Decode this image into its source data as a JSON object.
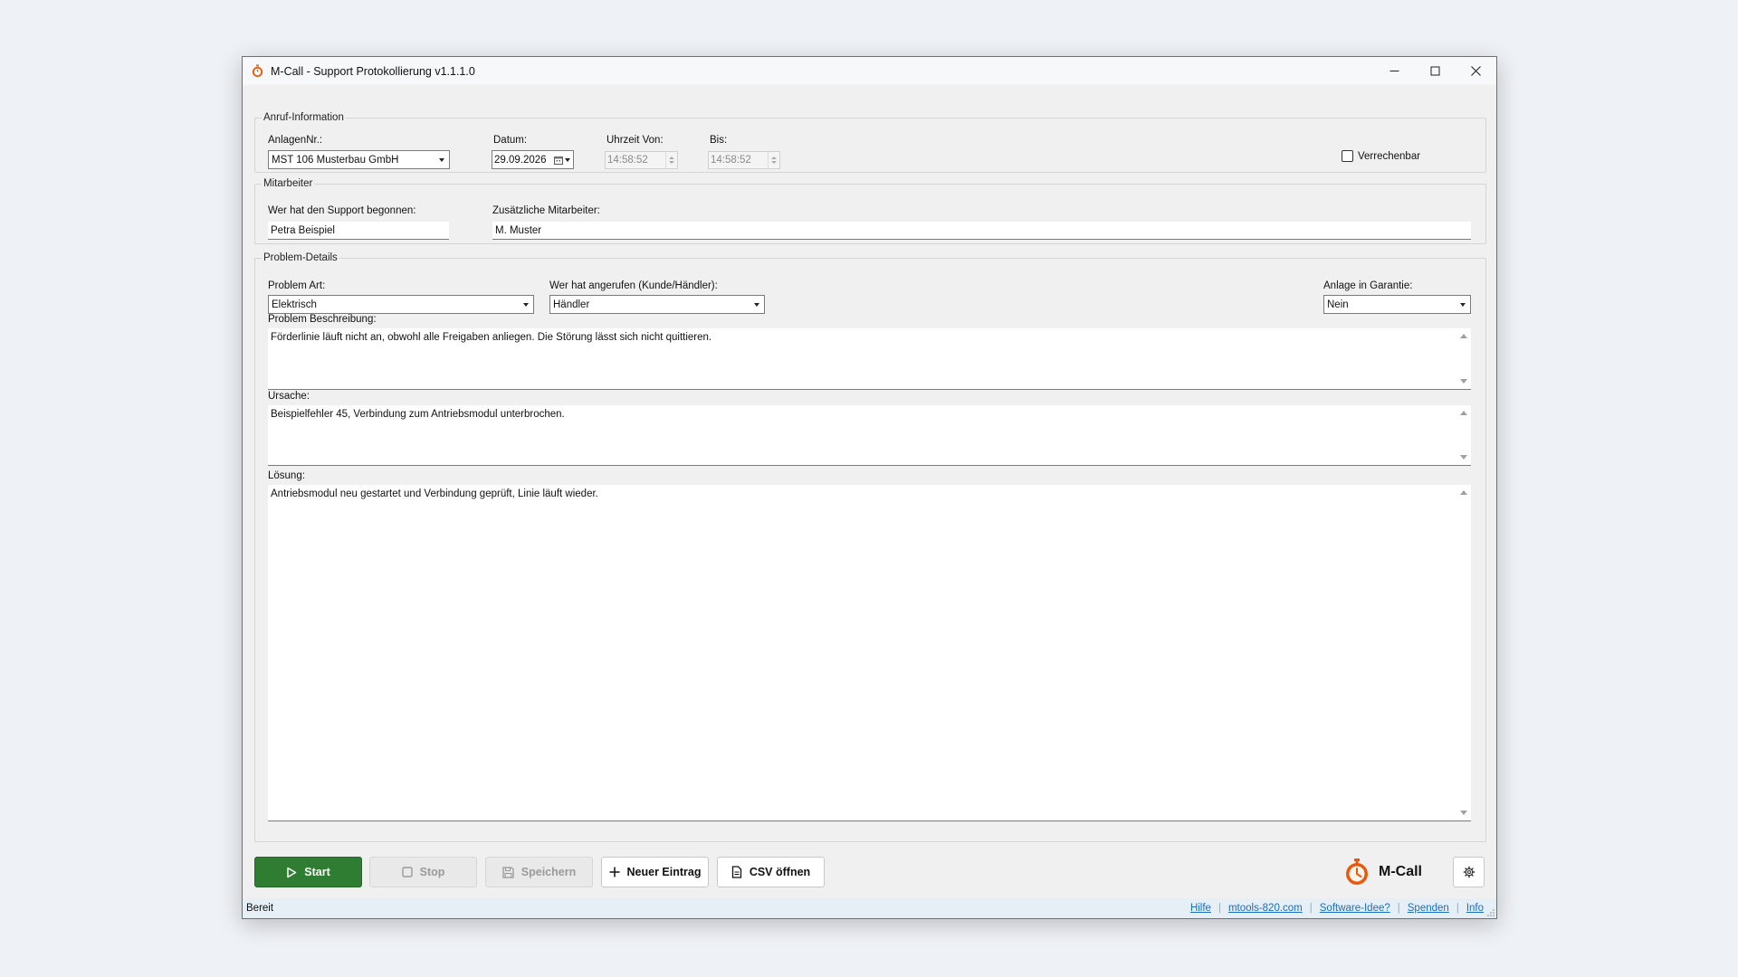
{
  "window": {
    "title": "M-Call - Support Protokollierung  v1.1.1.0"
  },
  "call_info": {
    "legend": "Anruf-Information",
    "anlage_label": "AnlagenNr.:",
    "anlage_value": "MST 106 Musterbau GmbH",
    "datum_label": "Datum:",
    "datum_value": "29.09.2026",
    "von_label": "Uhrzeit Von:",
    "von_value": "14:58:52",
    "bis_label": "Bis:",
    "bis_value": "14:58:52",
    "verrechenbar_label": "Verrechenbar",
    "verrechenbar_checked": false
  },
  "staff": {
    "legend": "Mitarbeiter",
    "started_label": "Wer hat den Support begonnen:",
    "started_value": "Petra Beispiel",
    "additional_label": "Zusätzliche Mitarbeiter:",
    "additional_value": "M. Muster"
  },
  "problem": {
    "legend": "Problem-Details",
    "art_label": "Problem Art:",
    "art_value": "Elektrisch",
    "caller_label": "Wer hat angerufen (Kunde/Händler):",
    "caller_value": "Händler",
    "warranty_label": "Anlage in Garantie:",
    "warranty_value": "Nein",
    "description_label": "Problem Beschreibung:",
    "description_value": "Förderlinie läuft nicht an, obwohl alle Freigaben anliegen. Die Störung lässt sich nicht quittieren.",
    "cause_label": "Ursache:",
    "cause_value": "Beispielfehler 45, Verbindung zum Antriebsmodul unterbrochen.",
    "solution_label": "Lösung:",
    "solution_value": "Antriebsmodul neu gestartet und Verbindung geprüft, Linie läuft wieder."
  },
  "toolbar": {
    "start_label": "Start",
    "stop_label": "Stop",
    "save_label": "Speichern",
    "new_label": "Neuer Eintrag",
    "csv_label": "CSV öffnen",
    "logo_text": "M-Call"
  },
  "status": {
    "text": "Bereit",
    "links": [
      "Hilfe",
      "mtools-820.com",
      "Software-Idee?",
      "Spenden",
      "Info"
    ]
  },
  "colors": {
    "start_button": "#2e7d32",
    "accent_orange": "#e8590c",
    "link": "#1a6ec5"
  }
}
